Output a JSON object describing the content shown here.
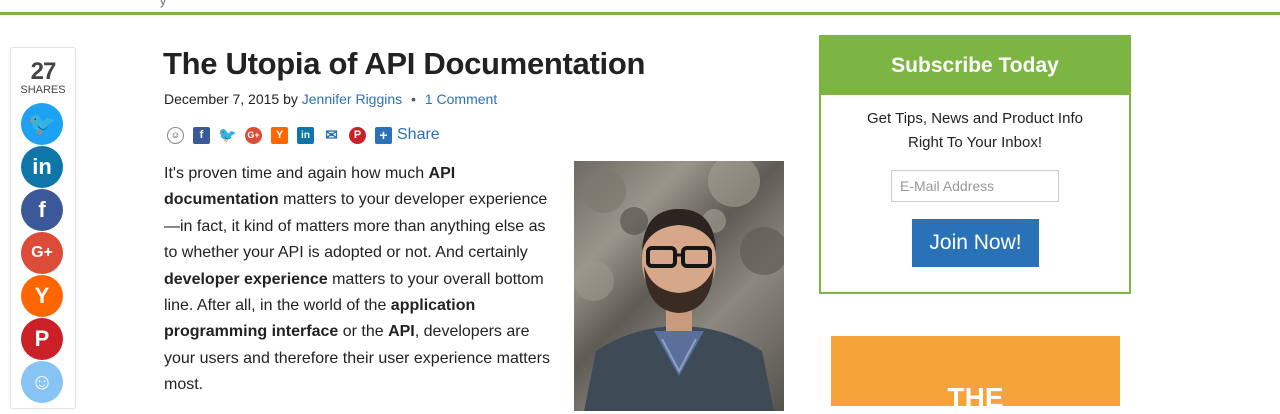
{
  "header": {
    "top_fragments": "y"
  },
  "share_rail": {
    "count": "27",
    "count_label": "SHARES",
    "buttons": [
      "twitter-icon",
      "linkedin-icon",
      "facebook-icon",
      "google-plus-icon",
      "hacker-news-icon",
      "pinterest-icon",
      "reddit-icon"
    ],
    "glyphs": {
      "twitter": "🐦",
      "linkedin": "in",
      "facebook": "f",
      "google_plus": "G+",
      "hacker_news": "Y",
      "pinterest": "P",
      "reddit": "☺"
    }
  },
  "article": {
    "title": "The Utopia of API Documentation",
    "date": "December 7, 2015",
    "by": "by",
    "author": "Jennifer Riggins",
    "separator": "•",
    "comments": "1 Comment",
    "share_label": "Share",
    "mini_share_glyphs": {
      "reddit": "☺",
      "facebook": "f",
      "twitter": "🐦",
      "google_plus": "G+",
      "hacker_news": "Y",
      "linkedin": "in",
      "email": "✉",
      "pinterest": "P",
      "plus": "+"
    },
    "paragraph": [
      {
        "text": "It's proven time and again how much ",
        "bold": false
      },
      {
        "text": "API documentation",
        "bold": true
      },
      {
        "text": " matters to your developer experience—in fact, it kind of matters more than anything else as to whether your API is adopted or not. And certainly ",
        "bold": false
      },
      {
        "text": "developer experience",
        "bold": true
      },
      {
        "text": " matters to your overall bottom line. After all, in the world of the ",
        "bold": false
      },
      {
        "text": "application programming interface",
        "bold": true
      },
      {
        "text": " or the ",
        "bold": false
      },
      {
        "text": "API",
        "bold": true
      },
      {
        "text": ", developers are your users and therefore their user experience matters most.",
        "bold": false
      }
    ]
  },
  "subscribe": {
    "heading": "Subscribe Today",
    "text_line1": "Get Tips, News and Product Info",
    "text_line2": "Right To Your Inbox!",
    "email_placeholder": "E-Mail Address",
    "button_label": "Join Now!"
  },
  "ad": {
    "text": "THE"
  },
  "colors": {
    "accent_green": "#7db543",
    "link_blue": "#2a72b8",
    "ad_orange": "#f6a33a"
  }
}
